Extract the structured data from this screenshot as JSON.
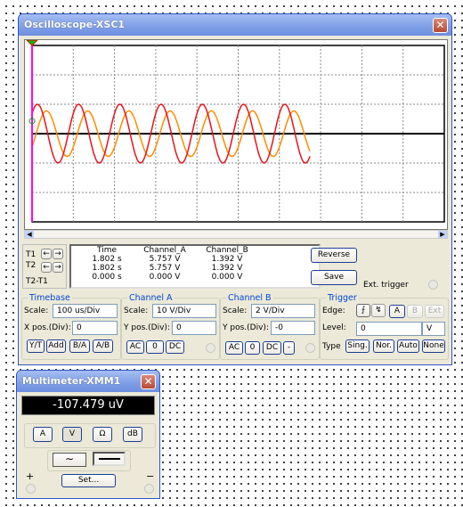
{
  "oscilloscope": {
    "title": "Oscilloscope-XSC1",
    "readout": {
      "headers": [
        "Time",
        "Channel_A",
        "Channel_B"
      ],
      "rows": [
        {
          "label": "T1",
          "time": "1.802 s",
          "a": "5.757 V",
          "b": "1.392 V"
        },
        {
          "label": "T2",
          "time": "1.802 s",
          "a": "5.757 V",
          "b": "1.392 V"
        },
        {
          "label": "T2-T1",
          "time": "0.000 s",
          "a": "0.000 V",
          "b": "0.000 V"
        }
      ]
    },
    "reverse_label": "Reverse",
    "save_label": "Save",
    "ext_trigger_label": "Ext. trigger",
    "timebase": {
      "title": "Timebase",
      "scale_label": "Scale:",
      "scale": "100 us/Div",
      "xpos_label": "X pos.(Div):",
      "xpos": "0",
      "buttons": [
        "Y/T",
        "Add",
        "B/A",
        "A/B"
      ]
    },
    "channel_a": {
      "title": "Channel A",
      "scale_label": "Scale:",
      "scale": "10  V/Div",
      "ypos_label": "Y pos.(Div):",
      "ypos": "0",
      "buttons": [
        "AC",
        "0",
        "DC"
      ]
    },
    "channel_b": {
      "title": "Channel B",
      "scale_label": "Scale:",
      "scale": "2  V/Div",
      "ypos_label": "Y pos.(Div):",
      "ypos": "-0",
      "buttons": [
        "AC",
        "0",
        "DC",
        "-"
      ]
    },
    "trigger": {
      "title": "Trigger",
      "edge_label": "Edge:",
      "edge_buttons": [
        "A",
        "B",
        "Ext"
      ],
      "level_label": "Level:",
      "level": "0",
      "level_unit": "V",
      "type_label": "Type",
      "type_buttons": [
        "Sing.",
        "Nor.",
        "Auto",
        "None"
      ]
    }
  },
  "chart_data": {
    "type": "line",
    "grid": true,
    "x_divisions": 10,
    "y_divisions": 6,
    "time_per_div_us": 100,
    "series": [
      {
        "channel": "A",
        "color": "#e8141c",
        "volts_per_div": 10,
        "amplitude_v": 10,
        "period_us": 100,
        "peak_at_us": 13,
        "end_us": 675
      },
      {
        "channel": "B",
        "color": "#ff8c00",
        "volts_per_div": 2,
        "amplitude_v": 1.55,
        "period_us": 100,
        "peak_at_us": 35,
        "end_us": 675
      }
    ],
    "trace_axis_color": "#000000",
    "cursor_color": "#ff00ff"
  },
  "multimeter": {
    "title": "Multimeter-XMM1",
    "display": "-107.479 uV",
    "buttons": [
      "A",
      "V",
      "Ω",
      "dB"
    ],
    "set_label": "Set...",
    "plus": "+",
    "minus": "−"
  }
}
